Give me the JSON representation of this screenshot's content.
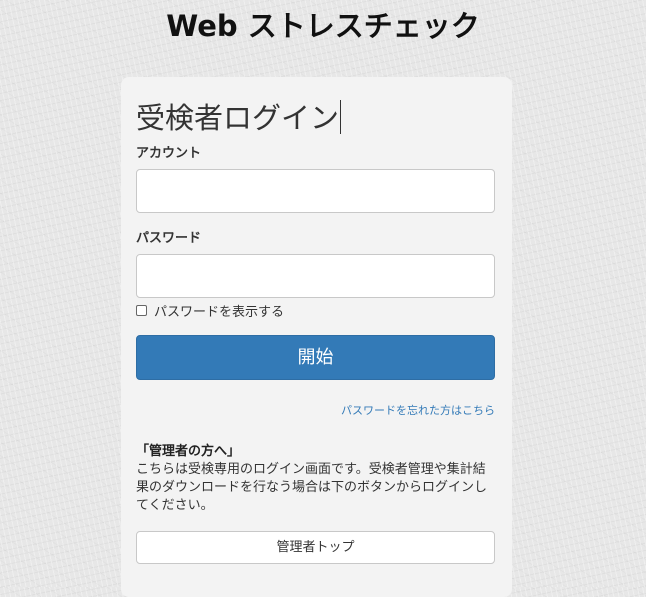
{
  "site": {
    "title": "Web ストレスチェック"
  },
  "login": {
    "heading": "受検者ログイン",
    "account_label": "アカウント",
    "account_value": "",
    "password_label": "パスワード",
    "password_value": "",
    "show_password_label": "パスワードを表示する",
    "show_password_checked": false,
    "start_button_label": "開始",
    "forgot_password_link": "パスワードを忘れた方はこちら"
  },
  "admin": {
    "heading": "「管理者の方へ」",
    "note": "こちらは受検専用のログイン画面です。受検者管理や集計結果のダウンロードを行なう場合は下のボタンからログインしてください。",
    "button_label": "管理者トップ"
  }
}
